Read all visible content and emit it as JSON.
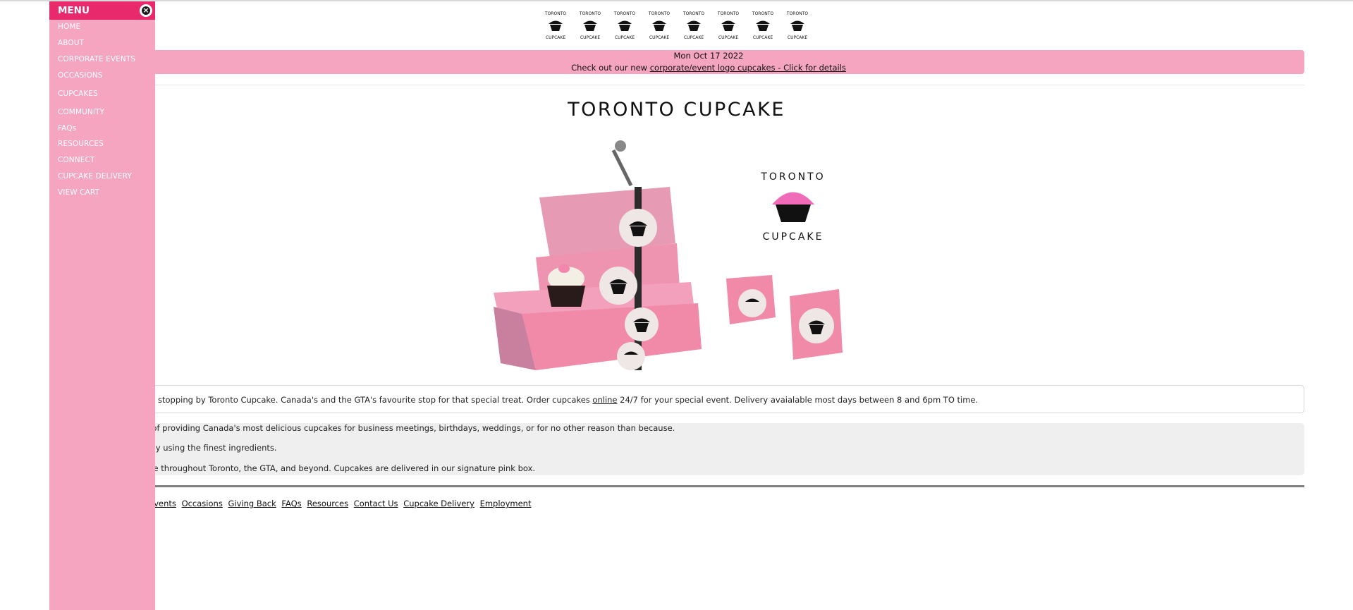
{
  "announcement": {
    "date": "Mon Oct 17 2022",
    "prefix": "Check out our new",
    "link": "corporate/event logo cupcakes - Click for details"
  },
  "site_title": "TORONTO CUPCAKE",
  "logo": {
    "top": "TORONTO",
    "bottom": "CUPCAKE"
  },
  "welcome": {
    "text_before": "stopping by Toronto Cupcake. Canada's and the GTA's favourite stop for that special treat. Order cupcakes",
    "link": "online",
    "text_after": "24/7 for your special event. Delivery avaialable most days between 8 and 6pm TO time."
  },
  "features": [
    "ar of providing Canada's most delicious cupcakes for business meetings, birthdays, weddings, or for no other reason than because.",
    "daily using the finest ingredients.",
    "able throughout Toronto, the GTA, and beyond. Cupcakes are delivered in our signature pink box."
  ],
  "footer_links": [
    "p Events",
    "Occasions",
    "Giving Back",
    "FAQs",
    "Resources",
    "Contact Us",
    "Cupcake Delivery",
    "Employment"
  ],
  "menu": {
    "title": "MENU",
    "items": [
      "HOME",
      "ABOUT",
      "CORPORATE EVENTS",
      "OCCASIONS",
      "CUPCAKES",
      "COMMUNITY",
      "FAQs",
      "RESOURCES",
      "CONNECT",
      "CUPCAKE DELIVERY",
      "VIEW CART"
    ]
  },
  "colors": {
    "menu_header": "#e8296b",
    "pink": "#f5a5c0",
    "box_pink": "#f08aa8"
  }
}
